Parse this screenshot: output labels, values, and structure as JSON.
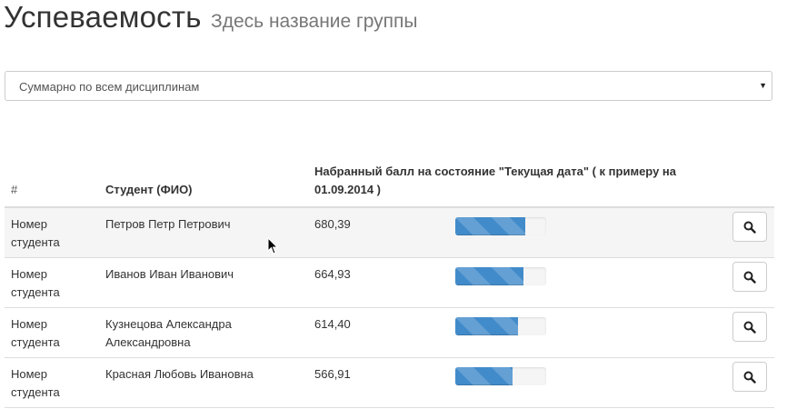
{
  "header": {
    "title": "Успеваемость",
    "subtitle": "Здесь название группы"
  },
  "discipline_select": {
    "selected": "Суммарно по всем дисциплинам"
  },
  "table": {
    "columns": {
      "number": "#",
      "student": "Студент (ФИО)",
      "score": "Набранный балл на состояние \"Текущая дата\" ( к примеру на 01.09.2014 )"
    },
    "rows": [
      {
        "number": "Номер студента",
        "student": "Петров Петр Петрович",
        "score": "680,39",
        "progress": 0.77
      },
      {
        "number": "Номер студента",
        "student": "Иванов Иван Иванович",
        "score": "664,93",
        "progress": 0.75
      },
      {
        "number": "Номер студента",
        "student": "Кузнецова Александра Александровна",
        "score": "614,40",
        "progress": 0.69
      },
      {
        "number": "Номер студента",
        "student": "Красная Любовь Ивановна",
        "score": "566,91",
        "progress": 0.63
      }
    ]
  },
  "icons": {
    "row_action": "search-icon",
    "select_arrow": "caret-down-icon"
  },
  "colors": {
    "progress_bar": "#428bca",
    "striped_row": "#f5f5f5"
  }
}
